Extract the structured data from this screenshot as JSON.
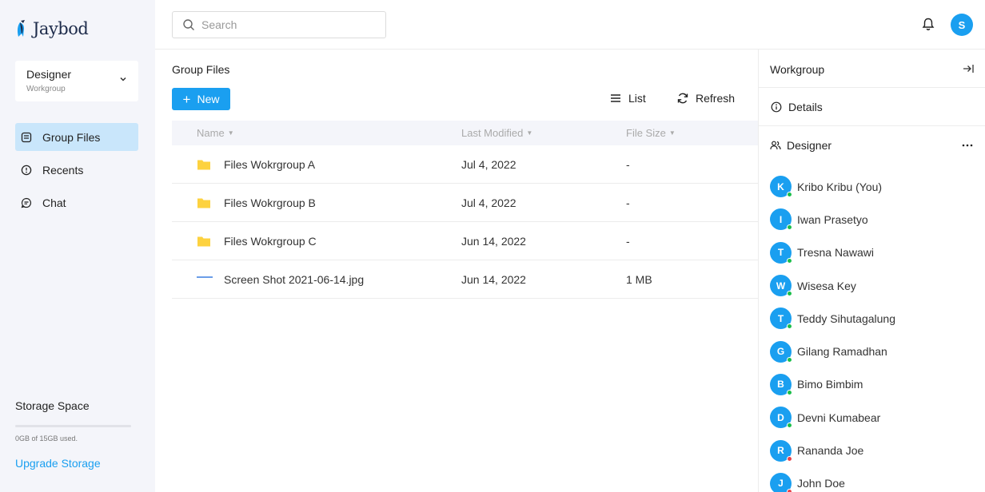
{
  "brand": {
    "name": "Jaybod"
  },
  "workspace": {
    "name": "Designer",
    "type": "Workgroup"
  },
  "nav": [
    {
      "label": "Group Files",
      "icon": "folder-file-icon",
      "active": true
    },
    {
      "label": "Recents",
      "icon": "clock-icon",
      "active": false
    },
    {
      "label": "Chat",
      "icon": "chat-icon",
      "active": false
    }
  ],
  "storage": {
    "title": "Storage Space",
    "used_text": "0GB of 15GB used.",
    "used_fraction": 0.0,
    "upgrade_label": "Upgrade Storage"
  },
  "search": {
    "placeholder": "Search"
  },
  "user": {
    "initial": "S"
  },
  "main": {
    "title": "Group Files",
    "new_label": "New",
    "list_label": "List",
    "refresh_label": "Refresh",
    "columns": {
      "name": "Name",
      "modified": "Last Modified",
      "size": "File Size"
    },
    "files": [
      {
        "name": "Files Wokrgroup A",
        "modified": "Jul 4, 2022",
        "size": "-",
        "kind": "folder"
      },
      {
        "name": "Files Wokrgroup B",
        "modified": "Jul 4, 2022",
        "size": "-",
        "kind": "folder"
      },
      {
        "name": "Files Wokrgroup C",
        "modified": "Jun 14, 2022",
        "size": "-",
        "kind": "folder"
      },
      {
        "name": "Screen Shot 2021-06-14.jpg",
        "modified": "Jun 14, 2022",
        "size": "1 MB",
        "kind": "image"
      }
    ]
  },
  "panel": {
    "title": "Workgroup",
    "details_label": "Details",
    "group_name": "Designer",
    "members": [
      {
        "initial": "K",
        "name": "Kribo Kribu (You)",
        "status": "online"
      },
      {
        "initial": "I",
        "name": "Iwan Prasetyo",
        "status": "online"
      },
      {
        "initial": "T",
        "name": "Tresna Nawawi",
        "status": "online"
      },
      {
        "initial": "W",
        "name": "Wisesa Key",
        "status": "online"
      },
      {
        "initial": "T",
        "name": "Teddy Sihutagalung",
        "status": "online"
      },
      {
        "initial": "G",
        "name": "Gilang Ramadhan",
        "status": "online"
      },
      {
        "initial": "B",
        "name": "Bimo Bimbim",
        "status": "online"
      },
      {
        "initial": "D",
        "name": "Devni Kumabear",
        "status": "online"
      },
      {
        "initial": "R",
        "name": "Rananda Joe",
        "status": "offline"
      },
      {
        "initial": "J",
        "name": "John Doe",
        "status": "offline"
      }
    ]
  },
  "colors": {
    "accent": "#1a9ff0",
    "active_nav_bg": "#c9e6fb",
    "folder": "#fdd23f",
    "online": "#1bbf4a",
    "offline": "#e8424a"
  }
}
